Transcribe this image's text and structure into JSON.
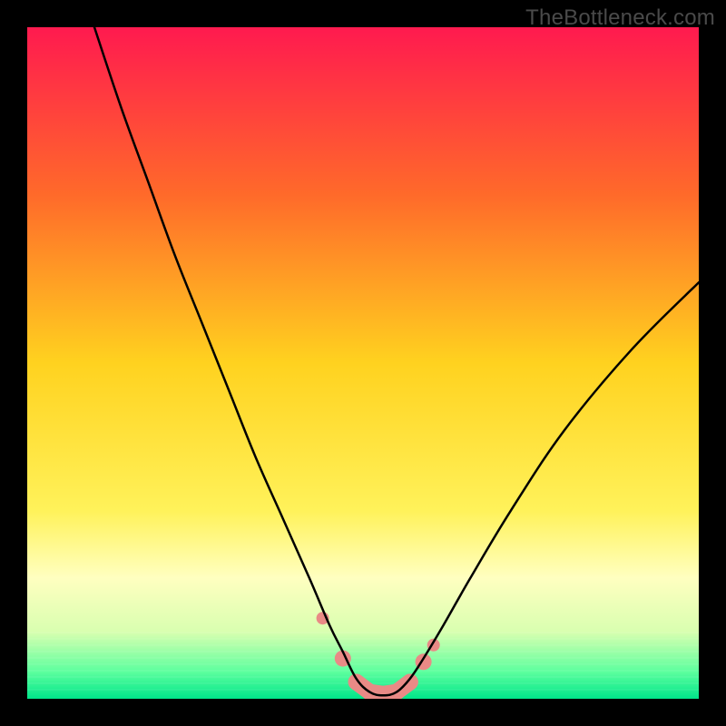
{
  "watermark": "TheBottleneck.com",
  "chart_data": {
    "type": "line",
    "title": "",
    "xlabel": "",
    "ylabel": "",
    "xlim": [
      0,
      100
    ],
    "ylim": [
      0,
      100
    ],
    "gradient_stops": [
      {
        "offset": 0,
        "color": "#ff1a4f"
      },
      {
        "offset": 25,
        "color": "#ff6a2a"
      },
      {
        "offset": 50,
        "color": "#ffd21f"
      },
      {
        "offset": 72,
        "color": "#fff25a"
      },
      {
        "offset": 82,
        "color": "#ffffc0"
      },
      {
        "offset": 90,
        "color": "#d9ffb0"
      },
      {
        "offset": 96,
        "color": "#5cff9e"
      },
      {
        "offset": 100,
        "color": "#00e58a"
      }
    ],
    "series": [
      {
        "name": "bottleneck-curve",
        "stroke": "#000000",
        "stroke_width": 2.5,
        "x": [
          10,
          14,
          18,
          22,
          26,
          30,
          34,
          38,
          42,
          45,
          47,
          49,
          51,
          53,
          55,
          57,
          59,
          62,
          66,
          72,
          80,
          90,
          100
        ],
        "y": [
          100,
          88,
          77,
          66,
          56,
          46,
          36,
          27,
          18,
          11,
          7,
          3,
          1,
          0.5,
          1,
          3,
          6,
          11,
          18,
          28,
          40,
          52,
          62
        ]
      }
    ],
    "markers": {
      "name": "bottom-highlight",
      "color": "#e98a86",
      "radius_small": 7,
      "radius_large": 9,
      "x": [
        44,
        47,
        49,
        51,
        53,
        55,
        57,
        59,
        60.5
      ],
      "y": [
        12,
        6,
        2.5,
        1,
        0.7,
        1,
        2.5,
        5.5,
        8
      ]
    }
  }
}
